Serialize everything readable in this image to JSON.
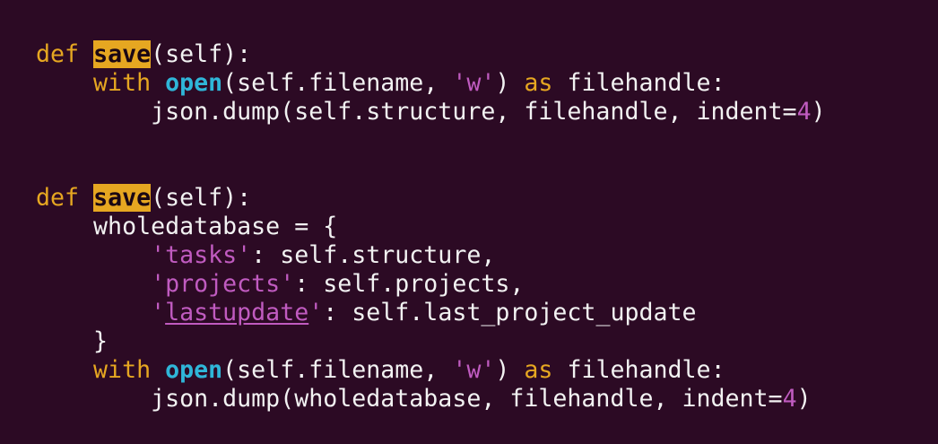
{
  "editor": {
    "lines": [
      [
        {
          "t": "def",
          "c": "kw"
        },
        {
          "t": " ",
          "c": "plain"
        },
        {
          "t": "save",
          "c": "hl"
        },
        {
          "t": "(self):",
          "c": "plain"
        }
      ],
      [
        {
          "t": "    ",
          "c": "plain"
        },
        {
          "t": "with",
          "c": "kw"
        },
        {
          "t": " ",
          "c": "plain"
        },
        {
          "t": "open",
          "c": "builtin"
        },
        {
          "t": "(self.filename, ",
          "c": "plain"
        },
        {
          "t": "'w'",
          "c": "str"
        },
        {
          "t": ") ",
          "c": "plain"
        },
        {
          "t": "as",
          "c": "kw"
        },
        {
          "t": " filehandle:",
          "c": "plain"
        }
      ],
      [
        {
          "t": "        json.dump(self.structure, filehandle, indent=",
          "c": "plain"
        },
        {
          "t": "4",
          "c": "num"
        },
        {
          "t": ")",
          "c": "plain"
        }
      ],
      [],
      [],
      [
        {
          "t": "def",
          "c": "kw"
        },
        {
          "t": " ",
          "c": "plain"
        },
        {
          "t": "save",
          "c": "hl"
        },
        {
          "t": "(self):",
          "c": "plain"
        }
      ],
      [
        {
          "t": "    wholedatabase = {",
          "c": "plain"
        }
      ],
      [
        {
          "t": "        ",
          "c": "plain"
        },
        {
          "t": "'tasks'",
          "c": "str"
        },
        {
          "t": ": self.structure,",
          "c": "plain"
        }
      ],
      [
        {
          "t": "        ",
          "c": "plain"
        },
        {
          "t": "'projects'",
          "c": "str"
        },
        {
          "t": ": self.projects,",
          "c": "plain"
        }
      ],
      [
        {
          "t": "        ",
          "c": "plain"
        },
        {
          "t": "'",
          "c": "str"
        },
        {
          "t": "lastupdate",
          "c": "str ul"
        },
        {
          "t": "'",
          "c": "str"
        },
        {
          "t": ": self.last_project_update",
          "c": "plain"
        }
      ],
      [
        {
          "t": "    }",
          "c": "plain"
        }
      ],
      [
        {
          "t": "    ",
          "c": "plain"
        },
        {
          "t": "with",
          "c": "kw"
        },
        {
          "t": " ",
          "c": "plain"
        },
        {
          "t": "open",
          "c": "builtin"
        },
        {
          "t": "(self.filename, ",
          "c": "plain"
        },
        {
          "t": "'w'",
          "c": "str"
        },
        {
          "t": ") ",
          "c": "plain"
        },
        {
          "t": "as",
          "c": "kw"
        },
        {
          "t": " filehandle:",
          "c": "plain"
        }
      ],
      [
        {
          "t": "        json.dump(wholedatabase, filehandle, indent=",
          "c": "plain"
        },
        {
          "t": "4",
          "c": "num"
        },
        {
          "t": ")",
          "c": "plain"
        }
      ]
    ]
  },
  "colors": {
    "background": "#2c0a24",
    "keyword": "#e6a721",
    "builtin": "#2fb6d8",
    "string": "#c05bc0",
    "text": "#f2f2f2",
    "search_highlight": "#e6a721"
  }
}
